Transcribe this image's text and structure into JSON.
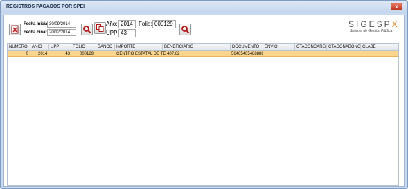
{
  "window": {
    "title": "REGISTROS PAGADOS POR SPEI",
    "close_label": "x"
  },
  "form": {
    "fecha_inicial_label": "Fecha Inicial:",
    "fecha_inicial_value": "30/09/2014",
    "fecha_final_label": "Fecha Final:",
    "fecha_final_value": "20/12/2014",
    "anio_label": "Año:",
    "anio_value": "2014",
    "upp_label": "UPP:",
    "upp_value": "43",
    "folio_label": "Folio:",
    "folio_value": "000129"
  },
  "icons": {
    "export": "pdf-export-icon",
    "search_dates": "search-icon",
    "copy": "copy-icon",
    "search_folio": "search-icon"
  },
  "logo": {
    "name_prefix": "SIGESP",
    "name_suffix": "X",
    "subtitle": "Sistema de Gestión Pública",
    "accent_color": "#e08a2a"
  },
  "table": {
    "columns": [
      "NUMERO",
      "ANIO",
      "UPP",
      "FOLIO",
      "BANCO",
      "IMPORTE",
      "BENEFICIARIO",
      "DOCUMENTO",
      "ENVIO",
      "CTACONCARGO",
      "CTACONABONO",
      "CLABE"
    ],
    "rows": [
      {
        "numero": "0",
        "anio": "2014",
        "upp": "43",
        "folio": "000129",
        "banco": "",
        "importe": "CENTRO ESTATAL DE TE 407.62",
        "beneficiario": "",
        "documento": "564654654888888",
        "envio": "",
        "ctaconcargo": "",
        "ctaconabono": "",
        "clabe": ""
      }
    ],
    "selected_row_color": "#fbd58b"
  }
}
